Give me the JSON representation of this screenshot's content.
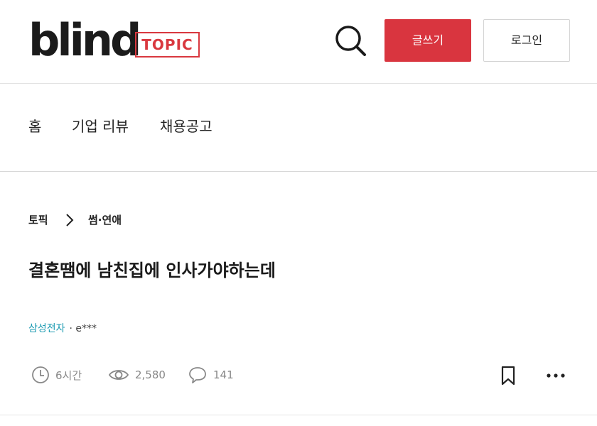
{
  "header": {
    "logo_text": "blind",
    "logo_badge": "TOPIC",
    "search_icon": "search-icon",
    "write_label": "글쓰기",
    "login_label": "로그인",
    "accent_color": "#d9353f"
  },
  "nav": {
    "items": [
      {
        "label": "홈"
      },
      {
        "label": "기업 리뷰"
      },
      {
        "label": "채용공고"
      }
    ]
  },
  "breadcrumb": {
    "root": "토픽",
    "separator_icon": "chevron-right-icon",
    "current": "썸·연애"
  },
  "post": {
    "title": "결혼땜에 남친집에 인사가야하는데",
    "company": "삼성전자",
    "author": "· e***",
    "company_color": "#1d9bb2",
    "time": "6시간",
    "views": "2,580",
    "comments": "141",
    "time_icon": "clock-icon",
    "views_icon": "eye-icon",
    "comments_icon": "speech-bubble-icon",
    "bookmark_icon": "bookmark-icon",
    "more_icon": "more-dots-icon"
  }
}
